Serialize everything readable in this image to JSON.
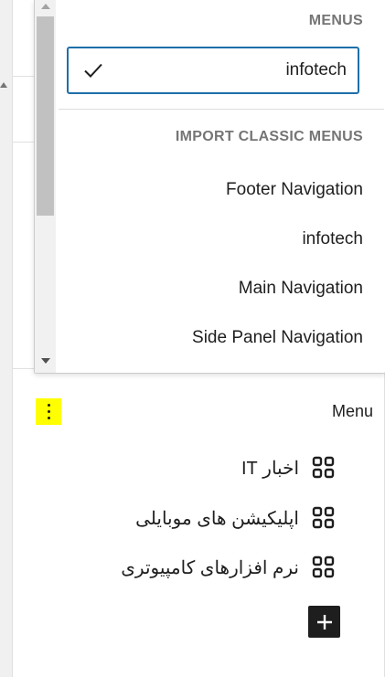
{
  "dropdown": {
    "menus_label": "MENUS",
    "selected_menu": "infotech",
    "import_label": "IMPORT CLASSIC MENUS",
    "classic_menus": [
      "Footer Navigation",
      "infotech",
      "Main Navigation",
      "Side Panel Navigation"
    ]
  },
  "menu_block": {
    "title": "Menu",
    "items": [
      {
        "label": "اخبار IT",
        "icon": "grid-icon"
      },
      {
        "label": "اپلیکیشن های موبایلی",
        "icon": "grid-icon"
      },
      {
        "label": "نرم افزارهای کامپیوتری",
        "icon": "grid-icon"
      }
    ]
  },
  "colors": {
    "selected_border": "#1e6fa8",
    "highlight": "#ffff00",
    "add_button": "#1e1e1e"
  }
}
